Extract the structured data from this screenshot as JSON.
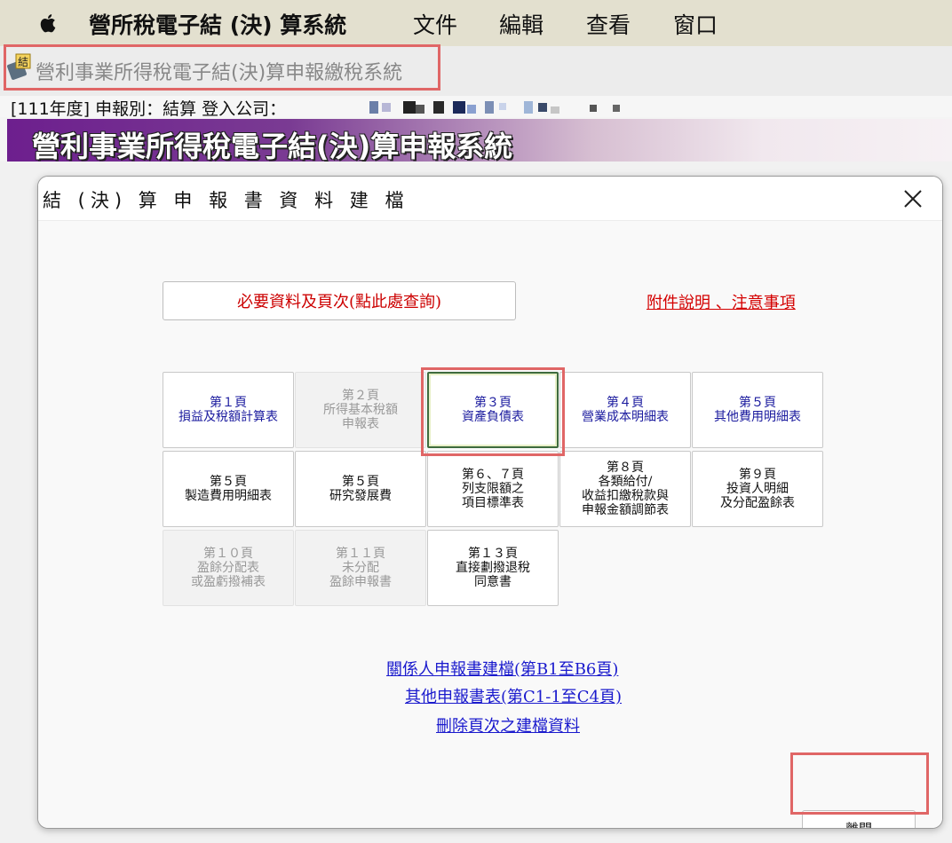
{
  "menubar": {
    "app_name": "營所稅電子結 (決) 算系統",
    "items": [
      "文件",
      "編輯",
      "查看",
      "窗口"
    ]
  },
  "window": {
    "title": "營利事業所得稅電子結(決)算申報繳稅系統",
    "icon_char": "結"
  },
  "status": {
    "text": "[111年度]  申報別：結算    登入公司："
  },
  "banner": {
    "title": "營利事業所得稅電子結(決)算申報系統"
  },
  "dialog": {
    "title": "結 (決) 算 申 報 書 資 料 建 檔",
    "required_button": "必要資料及頁次(點此處查詢)",
    "attach_link": "附件說明  、注意事項",
    "pages": [
      {
        "lines": [
          "第１頁",
          "損益及稅額計算表"
        ],
        "state": "enabled"
      },
      {
        "lines": [
          "第２頁",
          "所得基本稅額",
          "申報表"
        ],
        "state": "disabled"
      },
      {
        "lines": [
          "第３頁",
          "資產負債表"
        ],
        "state": "focused"
      },
      {
        "lines": [
          "第４頁",
          "營業成本明細表"
        ],
        "state": "enabled"
      },
      {
        "lines": [
          "第５頁",
          "其他費用明細表"
        ],
        "state": "enabled"
      },
      {
        "lines": [
          "第５頁",
          "製造費用明細表"
        ],
        "state": "black"
      },
      {
        "lines": [
          "第５頁",
          "研究發展費"
        ],
        "state": "black"
      },
      {
        "lines": [
          "第６、７頁",
          "列支限額之",
          "項目標準表"
        ],
        "state": "black"
      },
      {
        "lines": [
          "第８頁",
          "各類給付/",
          "收益扣繳稅款與",
          "申報金額調節表"
        ],
        "state": "black"
      },
      {
        "lines": [
          "第９頁",
          "投資人明細",
          "及分配盈餘表"
        ],
        "state": "black"
      },
      {
        "lines": [
          "第１０頁",
          "盈餘分配表",
          "或盈虧撥補表"
        ],
        "state": "disabled"
      },
      {
        "lines": [
          "第１１頁",
          "未分配",
          "盈餘申報書"
        ],
        "state": "disabled"
      },
      {
        "lines": [
          "第１３頁",
          "直接劃撥退稅",
          "同意書"
        ],
        "state": "black"
      }
    ],
    "links": [
      "關係人申報書建檔(第B1至B6頁)",
      "其他申報書表(第C1-1至C4頁)",
      "刪除頁次之建檔資料"
    ],
    "exit_button": "離開"
  }
}
